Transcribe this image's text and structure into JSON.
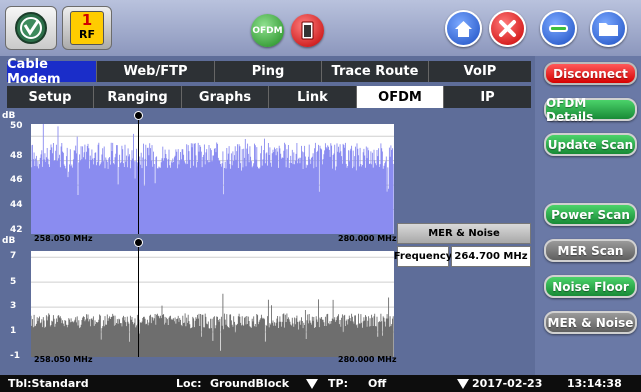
{
  "rf_indicator": {
    "number": "1",
    "label": "RF"
  },
  "ofdm_button": "OFDM",
  "tabs_row1": [
    "Cable Modem",
    "Web/FTP",
    "Ping",
    "Trace Route",
    "VoIP"
  ],
  "tabs_row2": [
    "Setup",
    "Ranging",
    "Graphs",
    "Link",
    "OFDM",
    "IP"
  ],
  "side_buttons": {
    "disconnect": "Disconnect",
    "ofdm_details": "OFDM Details",
    "update_scan": "Update Scan",
    "power_scan": "Power Scan",
    "mer_scan": "MER Scan",
    "noise_floor": "Noise Floor",
    "mer_noise": "MER & Noise"
  },
  "top_chart": {
    "unit": "dB",
    "y_ticks": [
      "50",
      "48",
      "46",
      "44",
      "42"
    ],
    "x_start": "258.050 MHz",
    "x_end": "280.000 MHz",
    "color": "#8a8cf0"
  },
  "bottom_chart": {
    "unit": "dB",
    "y_ticks": [
      "7",
      "5",
      "3",
      "1",
      "-1"
    ],
    "x_start": "258.050 MHz",
    "x_end": "280.000 MHz",
    "color": "#6e6e6e"
  },
  "info_box": {
    "title": "MER & Noise",
    "label": "Frequency",
    "value": "264.700 MHz"
  },
  "status": {
    "table": "Tbl:Standard",
    "loc_label": "Loc:",
    "loc_value": "GroundBlock",
    "tp_label": "TP:",
    "tp_value": "Off",
    "date": "2017-02-23",
    "time": "13:14:38"
  },
  "chart_data": [
    {
      "type": "bar",
      "title": "",
      "ylabel": "dB",
      "ylim": [
        42,
        51
      ],
      "xlim_labels": [
        "258.050 MHz",
        "280.000 MHz"
      ],
      "series": [
        {
          "name": "",
          "baseline": 48.4
        }
      ]
    },
    {
      "type": "bar",
      "title": "",
      "ylabel": "dB",
      "ylim": [
        -1,
        7.5
      ],
      "xlim_labels": [
        "258.050 MHz",
        "280.000 MHz"
      ],
      "series": [
        {
          "name": "",
          "baseline": 1.9
        }
      ]
    }
  ]
}
